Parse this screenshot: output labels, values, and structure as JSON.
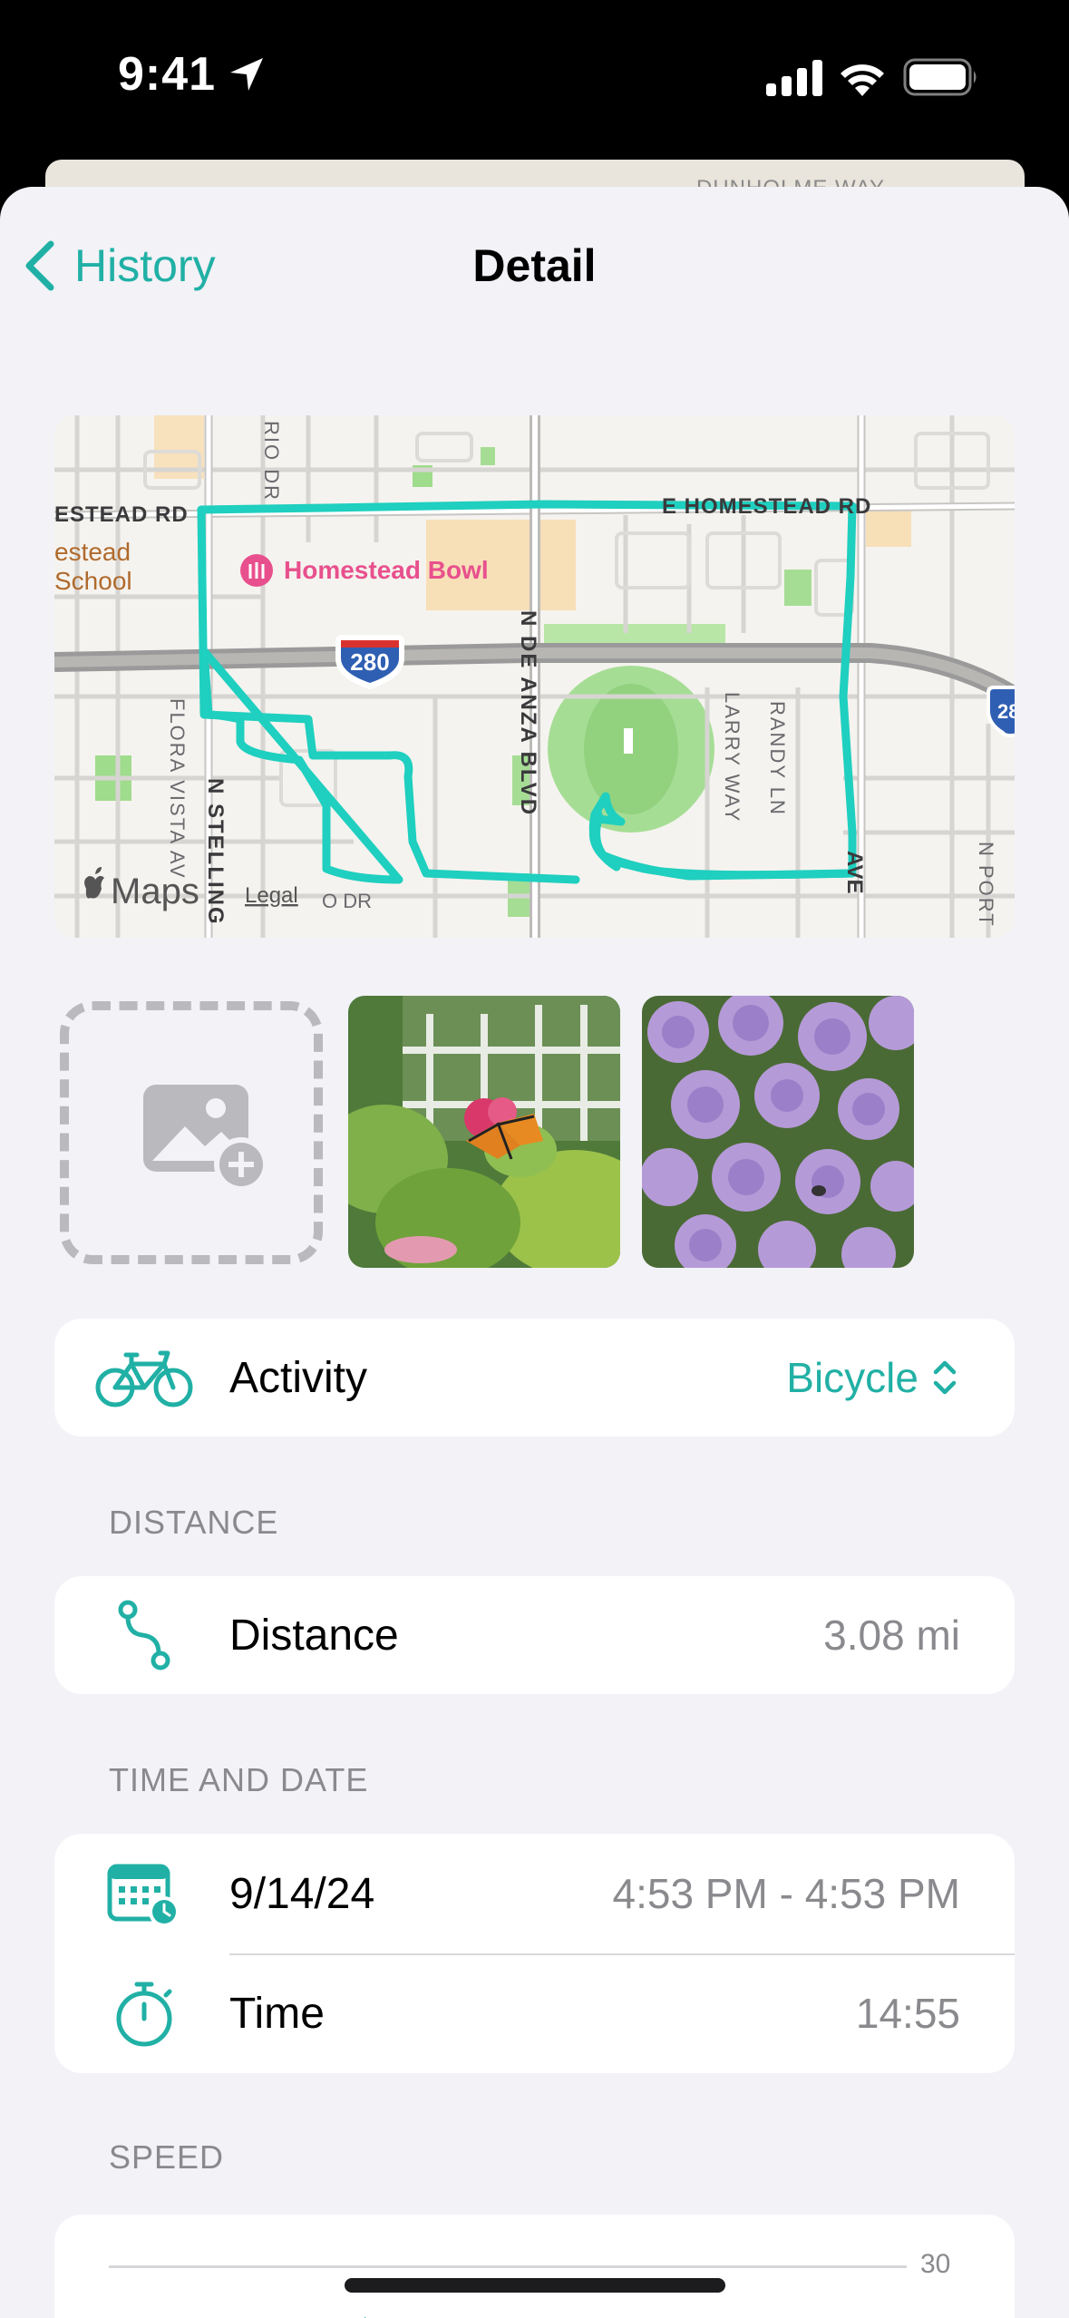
{
  "status_bar": {
    "time": "9:41"
  },
  "behind_sheet": {
    "street": "DUNHOLME WAY"
  },
  "nav": {
    "back_label": "History",
    "title": "Detail"
  },
  "map": {
    "labels": {
      "homestead_rd_left": "ESTEAD RD",
      "homestead_rd_right": "E HOMESTEAD RD",
      "school": "estead\nSchool",
      "school_line1": "estead",
      "school_line2": "School",
      "bowl": "Homestead Bowl",
      "highway": "280",
      "highway_right": "28",
      "de_anza": "N DE ANZA BLVD",
      "stelling": "N STELLING",
      "flora_vista": "FLORA VISTA AV",
      "larry": "LARRY WAY",
      "randy": "RANDY LN",
      "ave_right": "AVE",
      "portal": "N PORT",
      "rio": "RIO DR",
      "maps": "Maps",
      "legal": "Legal",
      "o_dr": "O DR"
    },
    "route_color": "#1fcfbf"
  },
  "photos": {
    "add_icon": "add-photo-icon"
  },
  "activity": {
    "label": "Activity",
    "value": "Bicycle",
    "icon": "bicycle-icon"
  },
  "distance": {
    "header": "DISTANCE",
    "label": "Distance",
    "value": "3.08 mi",
    "icon": "route-icon"
  },
  "time_date": {
    "header": "TIME AND DATE",
    "date_label": "9/14/24",
    "date_value": "4:53 PM - 4:53 PM",
    "time_label": "Time",
    "time_value": "14:55"
  },
  "speed": {
    "header": "SPEED",
    "axis_max": "30"
  },
  "colors": {
    "accent": "#21b0a5",
    "background": "#f2f2f7"
  }
}
